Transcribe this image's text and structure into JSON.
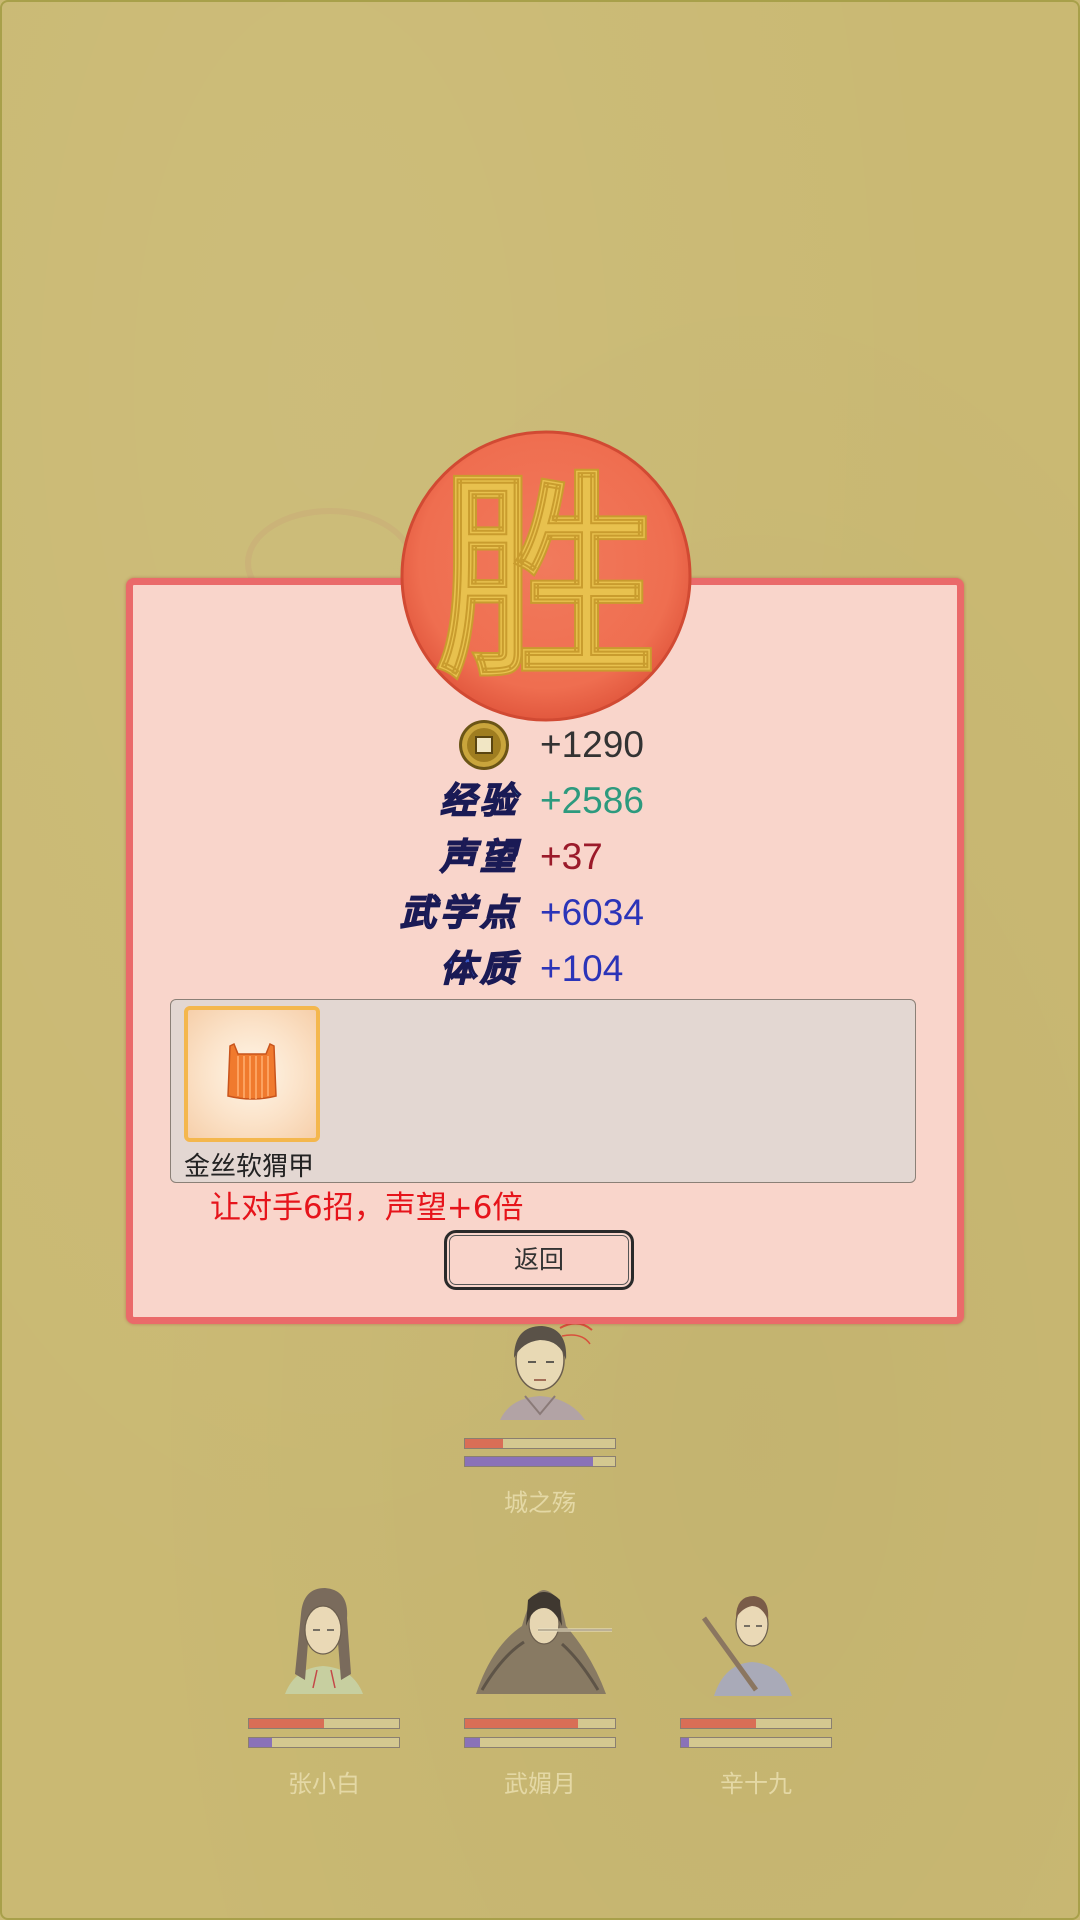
{
  "result": {
    "badge_char": "胜",
    "rewards": [
      {
        "key": "coins",
        "label": "",
        "value": "+1290",
        "icon": "coin-icon",
        "color": "#333333"
      },
      {
        "key": "exp",
        "label": "经验",
        "value": "+2586",
        "color": "#2d9a7e",
        "label_color": "#3aa7c8"
      },
      {
        "key": "reputation",
        "label": "声望",
        "value": "+37",
        "color": "#9b1a2a",
        "label_color": "#d0203c"
      },
      {
        "key": "martial_points",
        "label": "武学点",
        "value": "+6034",
        "color": "#2b34b8",
        "label_color": "#3a58c8"
      },
      {
        "key": "constitution",
        "label": "体质",
        "value": "+104",
        "color": "#2b34b8",
        "label_color": "#3a58c8"
      }
    ],
    "items": [
      {
        "name": "金丝软猬甲",
        "icon": "armor-vest-icon"
      }
    ],
    "bonus_text": "让对手6招，声望+6倍",
    "back_label": "返回"
  },
  "characters": {
    "enemy": {
      "name": "城之殇",
      "hp": 0.25,
      "mp": 0.85
    },
    "party": [
      {
        "name": "张小白",
        "hp": 0.5,
        "mp": 0.15
      },
      {
        "name": "武媚月",
        "hp": 0.75,
        "mp": 0.1
      },
      {
        "name": "辛十九",
        "hp": 0.5,
        "mp": 0.05
      }
    ]
  }
}
